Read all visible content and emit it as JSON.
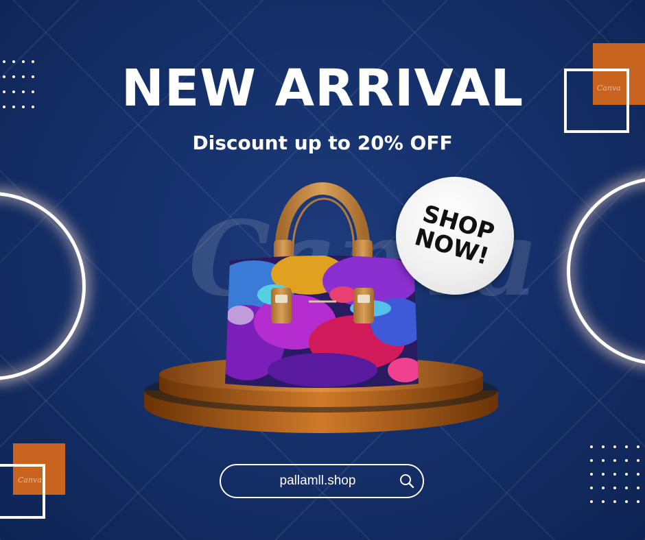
{
  "headline": "NEW ARRIVAL",
  "subheadline": "Discount up to 20% OFF",
  "badge": {
    "line1": "SHOP",
    "line2": "NOW!"
  },
  "search": {
    "url": "pallamll.shop",
    "icon": "search-icon"
  },
  "watermark": "Canva",
  "canva_tags": [
    "Canva",
    "Canva"
  ],
  "colors": {
    "background": "#15306a",
    "accent_orange": "#c8641f",
    "text": "#ffffff",
    "bag_strap": "#c8914a",
    "podium": "#c9772e"
  }
}
